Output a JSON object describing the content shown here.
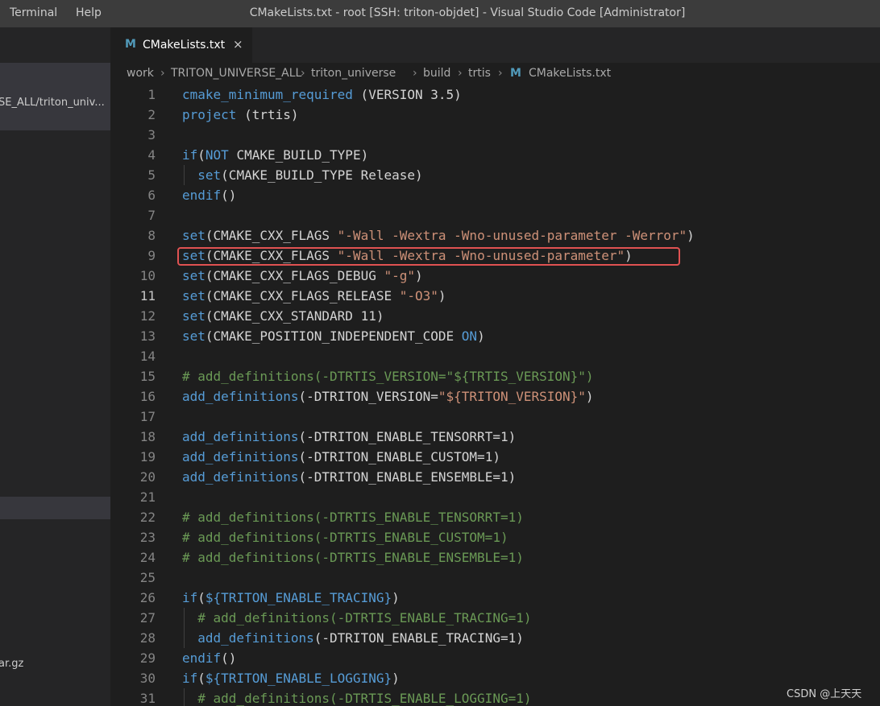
{
  "menu": [
    "Terminal",
    "Help"
  ],
  "window_title": "CMakeLists.txt - root [SSH: triton-objdet] - Visual Studio Code [Administrator]",
  "sidebar": {
    "active_item": "SE_ALL/triton_univ...",
    "file_item": "ar.gz"
  },
  "tab": {
    "icon": "M",
    "label": "CMakeLists.txt",
    "close": "×"
  },
  "breadcrumb": [
    "work",
    "TRITON_UNIVERSE_ALL",
    "triton_universe",
    "build",
    "trtis",
    "CMakeLists.txt"
  ],
  "breadcrumb_sep": "›",
  "current_line": 11,
  "highlighted_line": 9,
  "lines": [
    {
      "n": "1",
      "indent": false,
      "t": [
        [
          "kw",
          "cmake_minimum_required"
        ],
        [
          "df",
          " (VERSION 3.5)"
        ]
      ]
    },
    {
      "n": "2",
      "indent": false,
      "t": [
        [
          "kw",
          "project"
        ],
        [
          "df",
          " (trtis)"
        ]
      ]
    },
    {
      "n": "3",
      "indent": false,
      "t": []
    },
    {
      "n": "4",
      "indent": false,
      "t": [
        [
          "kw",
          "if"
        ],
        [
          "df",
          "("
        ],
        [
          "kw",
          "NOT"
        ],
        [
          "df",
          " CMAKE_BUILD_TYPE)"
        ]
      ]
    },
    {
      "n": "5",
      "indent": true,
      "t": [
        [
          "df",
          "  "
        ],
        [
          "kw",
          "set"
        ],
        [
          "df",
          "(CMAKE_BUILD_TYPE Release)"
        ]
      ]
    },
    {
      "n": "6",
      "indent": false,
      "t": [
        [
          "kw",
          "endif"
        ],
        [
          "df",
          "()"
        ]
      ]
    },
    {
      "n": "7",
      "indent": false,
      "t": []
    },
    {
      "n": "8",
      "indent": false,
      "t": [
        [
          "kw",
          "set"
        ],
        [
          "df",
          "(CMAKE_CXX_FLAGS "
        ],
        [
          "str",
          "\"-Wall -Wextra -Wno-unused-parameter -Werror\""
        ],
        [
          "df",
          ")"
        ]
      ]
    },
    {
      "n": "9",
      "indent": false,
      "t": [
        [
          "kw",
          "set"
        ],
        [
          "df",
          "(CMAKE_CXX_FLAGS "
        ],
        [
          "str",
          "\"-Wall -Wextra -Wno-unused-parameter\""
        ],
        [
          "df",
          ")"
        ]
      ]
    },
    {
      "n": "10",
      "indent": false,
      "t": [
        [
          "kw",
          "set"
        ],
        [
          "df",
          "(CMAKE_CXX_FLAGS_DEBUG "
        ],
        [
          "str",
          "\"-g\""
        ],
        [
          "df",
          ")"
        ]
      ]
    },
    {
      "n": "11",
      "indent": false,
      "t": [
        [
          "kw",
          "set"
        ],
        [
          "df",
          "(CMAKE_CXX_FLAGS_RELEASE "
        ],
        [
          "str",
          "\"-O3\""
        ],
        [
          "df",
          ")"
        ]
      ]
    },
    {
      "n": "12",
      "indent": false,
      "t": [
        [
          "kw",
          "set"
        ],
        [
          "df",
          "(CMAKE_CXX_STANDARD 11)"
        ]
      ]
    },
    {
      "n": "13",
      "indent": false,
      "t": [
        [
          "kw",
          "set"
        ],
        [
          "df",
          "(CMAKE_POSITION_INDEPENDENT_CODE "
        ],
        [
          "kw",
          "ON"
        ],
        [
          "df",
          ")"
        ]
      ]
    },
    {
      "n": "14",
      "indent": false,
      "t": []
    },
    {
      "n": "15",
      "indent": false,
      "t": [
        [
          "cm",
          "# add_definitions(-DTRTIS_VERSION=\"${TRTIS_VERSION}\")"
        ]
      ]
    },
    {
      "n": "16",
      "indent": false,
      "t": [
        [
          "kw",
          "add_definitions"
        ],
        [
          "df",
          "(-DTRITON_VERSION="
        ],
        [
          "str",
          "\"${TRITON_VERSION}\""
        ],
        [
          "df",
          ")"
        ]
      ]
    },
    {
      "n": "17",
      "indent": false,
      "t": []
    },
    {
      "n": "18",
      "indent": false,
      "t": [
        [
          "kw",
          "add_definitions"
        ],
        [
          "df",
          "(-DTRITON_ENABLE_TENSORRT=1)"
        ]
      ]
    },
    {
      "n": "19",
      "indent": false,
      "t": [
        [
          "kw",
          "add_definitions"
        ],
        [
          "df",
          "(-DTRITON_ENABLE_CUSTOM=1)"
        ]
      ]
    },
    {
      "n": "20",
      "indent": false,
      "t": [
        [
          "kw",
          "add_definitions"
        ],
        [
          "df",
          "(-DTRITON_ENABLE_ENSEMBLE=1)"
        ]
      ]
    },
    {
      "n": "21",
      "indent": false,
      "t": []
    },
    {
      "n": "22",
      "indent": false,
      "t": [
        [
          "cm",
          "# add_definitions(-DTRTIS_ENABLE_TENSORRT=1)"
        ]
      ]
    },
    {
      "n": "23",
      "indent": false,
      "t": [
        [
          "cm",
          "# add_definitions(-DTRTIS_ENABLE_CUSTOM=1)"
        ]
      ]
    },
    {
      "n": "24",
      "indent": false,
      "t": [
        [
          "cm",
          "# add_definitions(-DTRTIS_ENABLE_ENSEMBLE=1)"
        ]
      ]
    },
    {
      "n": "25",
      "indent": false,
      "t": []
    },
    {
      "n": "26",
      "indent": false,
      "t": [
        [
          "kw",
          "if"
        ],
        [
          "df",
          "("
        ],
        [
          "kw",
          "${TRITON_ENABLE_TRACING}"
        ],
        [
          "df",
          ")"
        ]
      ]
    },
    {
      "n": "27",
      "indent": true,
      "t": [
        [
          "df",
          "  "
        ],
        [
          "cm",
          "# add_definitions(-DTRTIS_ENABLE_TRACING=1)"
        ]
      ]
    },
    {
      "n": "28",
      "indent": true,
      "t": [
        [
          "df",
          "  "
        ],
        [
          "kw",
          "add_definitions"
        ],
        [
          "df",
          "(-DTRITON_ENABLE_TRACING=1)"
        ]
      ]
    },
    {
      "n": "29",
      "indent": false,
      "t": [
        [
          "kw",
          "endif"
        ],
        [
          "df",
          "()"
        ]
      ]
    },
    {
      "n": "30",
      "indent": false,
      "t": [
        [
          "kw",
          "if"
        ],
        [
          "df",
          "("
        ],
        [
          "kw",
          "${TRITON_ENABLE_LOGGING}"
        ],
        [
          "df",
          ")"
        ]
      ]
    },
    {
      "n": "31",
      "indent": true,
      "t": [
        [
          "df",
          "  "
        ],
        [
          "cm",
          "# add_definitions(-DTRTIS_ENABLE_LOGGING=1)"
        ]
      ]
    }
  ],
  "watermark": "CSDN @上天天"
}
